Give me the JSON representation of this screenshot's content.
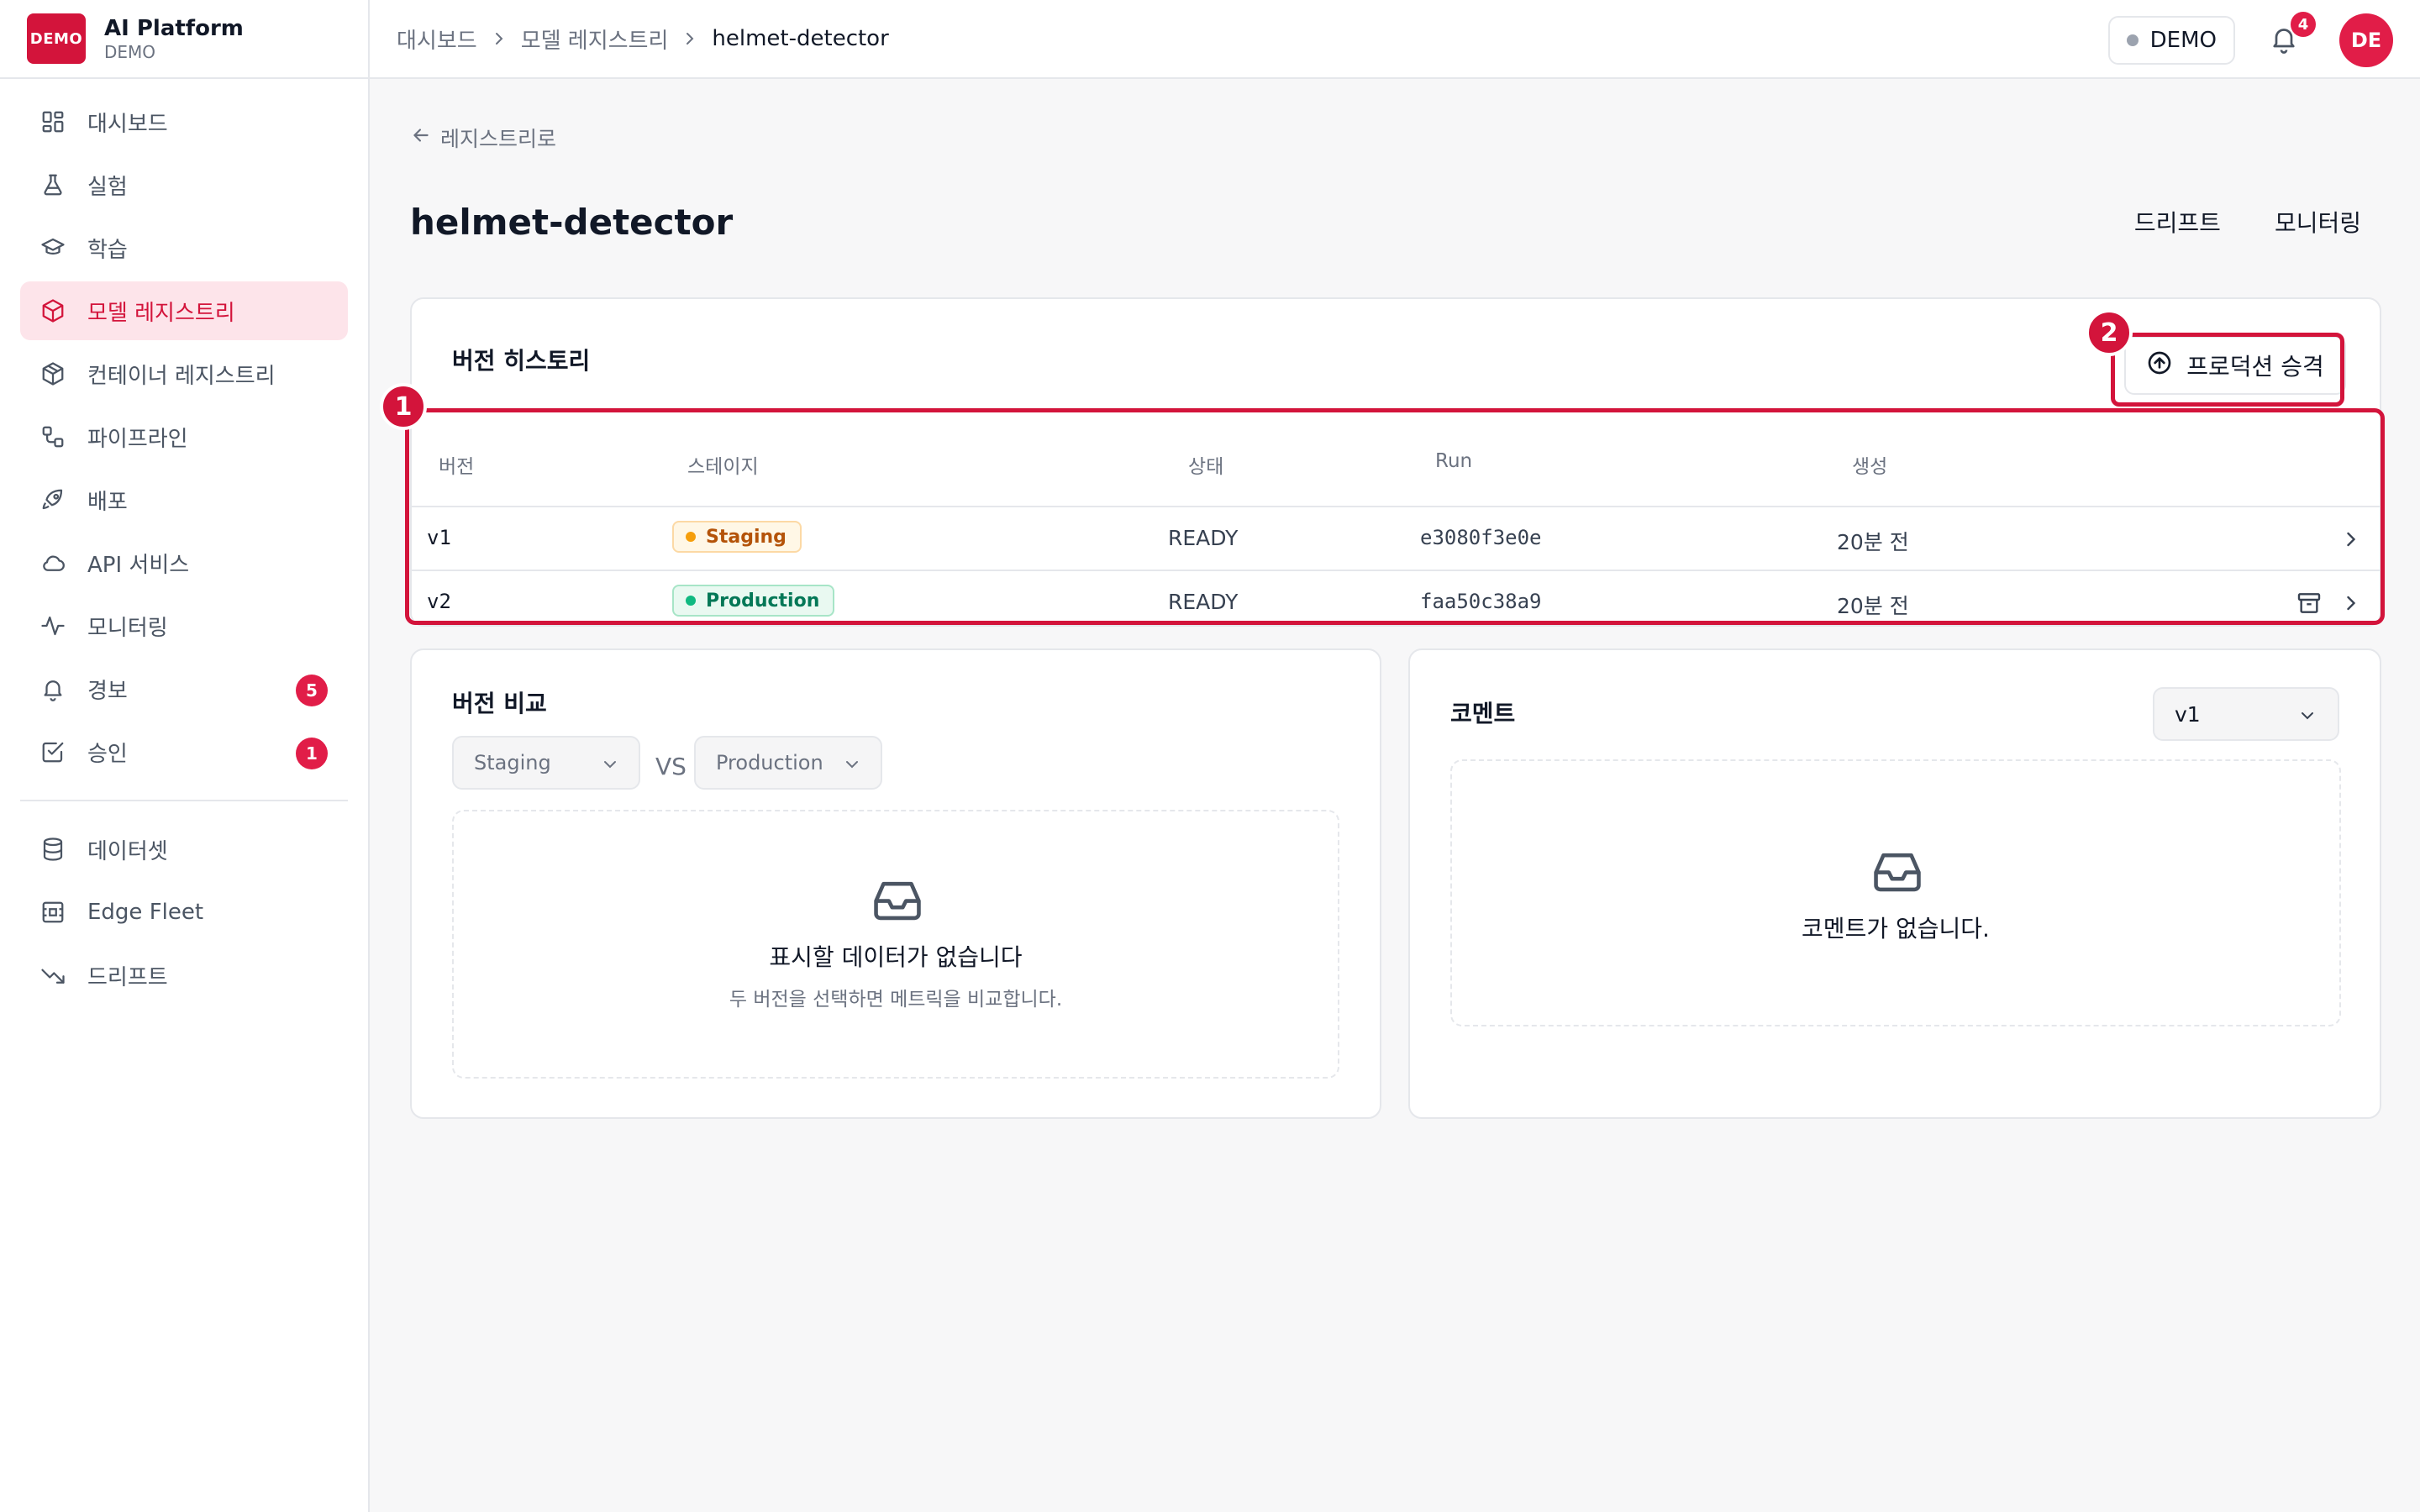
{
  "brand": {
    "logo_text": "DEMO",
    "title": "AI Platform",
    "subtitle": "DEMO"
  },
  "sidebar": {
    "items": [
      {
        "label": "대시보드",
        "icon": "dashboard-grid-icon"
      },
      {
        "label": "실험",
        "icon": "flask-icon"
      },
      {
        "label": "학습",
        "icon": "graduation-cap-icon"
      },
      {
        "label": "모델 레지스트리",
        "icon": "cube-icon",
        "active": true
      },
      {
        "label": "컨테이너 레지스트리",
        "icon": "package-icon"
      },
      {
        "label": "파이프라인",
        "icon": "workflow-icon"
      },
      {
        "label": "배포",
        "icon": "rocket-icon"
      },
      {
        "label": "API 서비스",
        "icon": "cloud-icon"
      },
      {
        "label": "모니터링",
        "icon": "activity-icon"
      },
      {
        "label": "경보",
        "icon": "bell-icon",
        "badge": "5"
      },
      {
        "label": "승인",
        "icon": "check-square-icon",
        "badge": "1"
      }
    ],
    "secondary_items": [
      {
        "label": "데이터셋",
        "icon": "database-icon"
      },
      {
        "label": "Edge Fleet",
        "icon": "chip-icon"
      },
      {
        "label": "드리프트",
        "icon": "trending-down-icon"
      }
    ]
  },
  "topbar": {
    "breadcrumb": [
      "대시보드",
      "모델 레지스트리",
      "helmet-detector"
    ],
    "env_label": "DEMO",
    "notification_count": "4",
    "avatar_initials": "DE"
  },
  "page": {
    "back_label": "레지스트리로",
    "title": "helmet-detector",
    "actions": [
      "드리프트",
      "모니터링"
    ]
  },
  "history": {
    "title": "버전 히스토리",
    "promote_label": "프로덕션 승격",
    "columns": [
      "버전",
      "스테이지",
      "상태",
      "Run",
      "생성"
    ],
    "rows": [
      {
        "version": "v1",
        "stage": "Staging",
        "status": "READY",
        "run": "e3080f3e0e",
        "created": "20분 전",
        "archive": false
      },
      {
        "version": "v2",
        "stage": "Production",
        "status": "READY",
        "run": "faa50c38a9",
        "created": "20분 전",
        "archive": true
      }
    ]
  },
  "annotations": {
    "one": "1",
    "two": "2"
  },
  "compare": {
    "title": "버전 비교",
    "left_select": "Staging",
    "vs": "VS",
    "right_select": "Production",
    "empty_title": "표시할 데이터가 없습니다",
    "empty_sub": "두 버전을 선택하면 메트릭을 비교합니다."
  },
  "comments": {
    "title": "코멘트",
    "version_select": "v1",
    "empty_text": "코멘트가 없습니다."
  },
  "colors": {
    "accent": "#d3143b",
    "staging": "#b45309",
    "production": "#047857"
  }
}
